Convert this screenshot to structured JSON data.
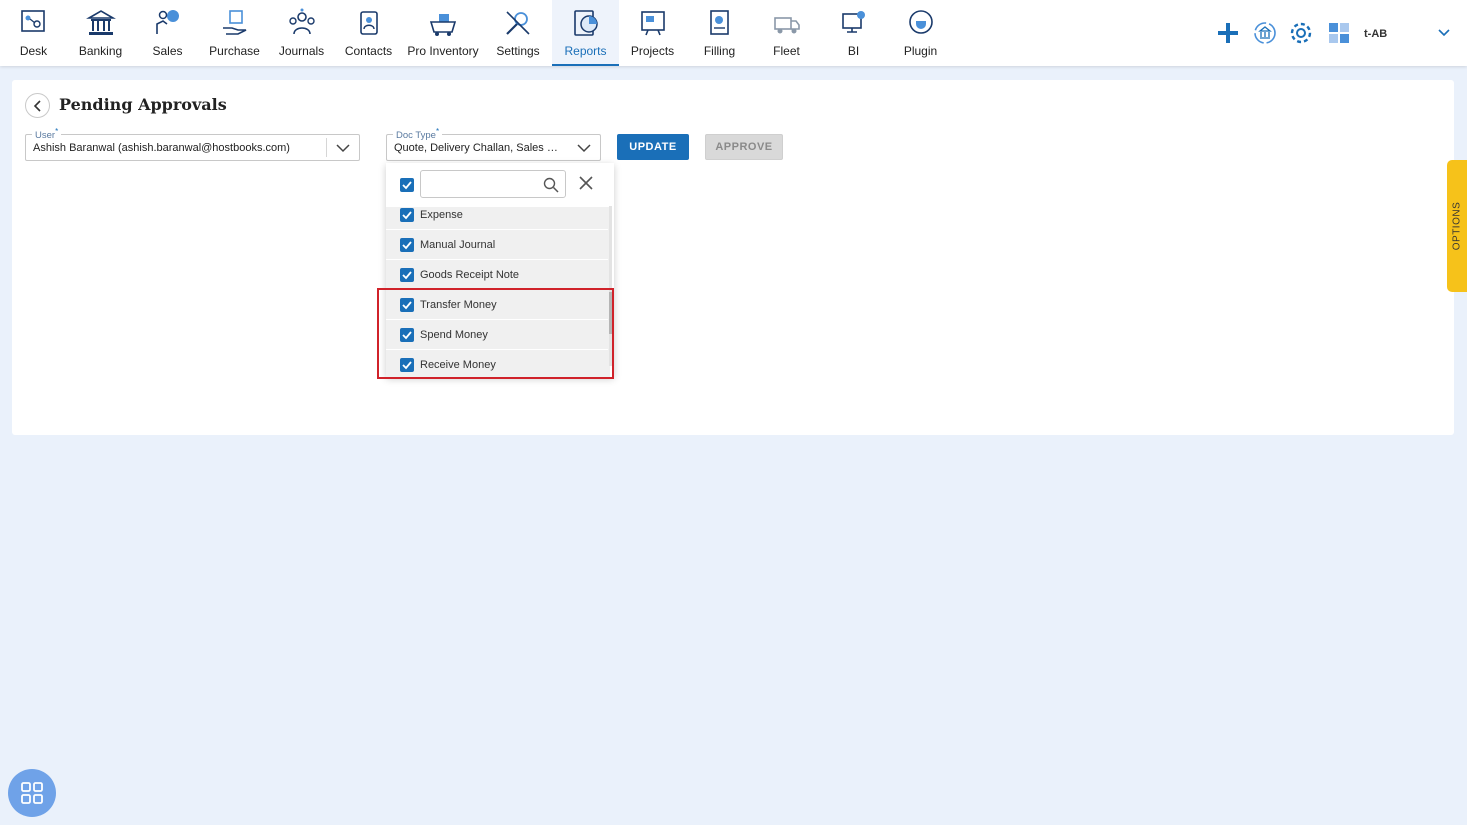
{
  "nav": {
    "items": [
      {
        "label": "Desk",
        "icon": "desk-icon"
      },
      {
        "label": "Banking",
        "icon": "bank-icon"
      },
      {
        "label": "Sales",
        "icon": "sales-icon"
      },
      {
        "label": "Purchase",
        "icon": "purchase-icon"
      },
      {
        "label": "Journals",
        "icon": "journals-icon"
      },
      {
        "label": "Contacts",
        "icon": "contacts-icon"
      },
      {
        "label": "Pro Inventory",
        "icon": "inventory-icon"
      },
      {
        "label": "Settings",
        "icon": "settings-tools-icon"
      },
      {
        "label": "Reports",
        "icon": "reports-icon",
        "active": true
      },
      {
        "label": "Projects",
        "icon": "projects-icon"
      },
      {
        "label": "Filling",
        "icon": "filling-icon"
      },
      {
        "label": "Fleet",
        "icon": "fleet-icon"
      },
      {
        "label": "BI",
        "icon": "bi-icon"
      },
      {
        "label": "Plugin",
        "icon": "plugin-icon"
      }
    ],
    "company": "t-AB",
    "accent": "#1a6fb8"
  },
  "page": {
    "title": "Pending Approvals"
  },
  "filters": {
    "user_label": "User",
    "user_value": "Ashish Baranwal (ashish.baranwal@hostbooks.com)",
    "doctype_label": "Doc Type",
    "doctype_value": "Quote, Delivery Challan, Sales Or..."
  },
  "buttons": {
    "update": "UPDATE",
    "approve": "APPROVE"
  },
  "dropdown": {
    "search_placeholder": "",
    "options": [
      {
        "label": "Expense",
        "checked": true
      },
      {
        "label": "Manual Journal",
        "checked": true
      },
      {
        "label": "Goods Receipt Note",
        "checked": true
      },
      {
        "label": "Transfer Money",
        "checked": true
      },
      {
        "label": "Spend Money",
        "checked": true
      },
      {
        "label": "Receive Money",
        "checked": true
      }
    ]
  },
  "options_tab": "OPTIONS",
  "colors": {
    "highlight": "#d0222a",
    "options_tab": "#f6c21a",
    "apps_button": "#6fa2e8"
  }
}
